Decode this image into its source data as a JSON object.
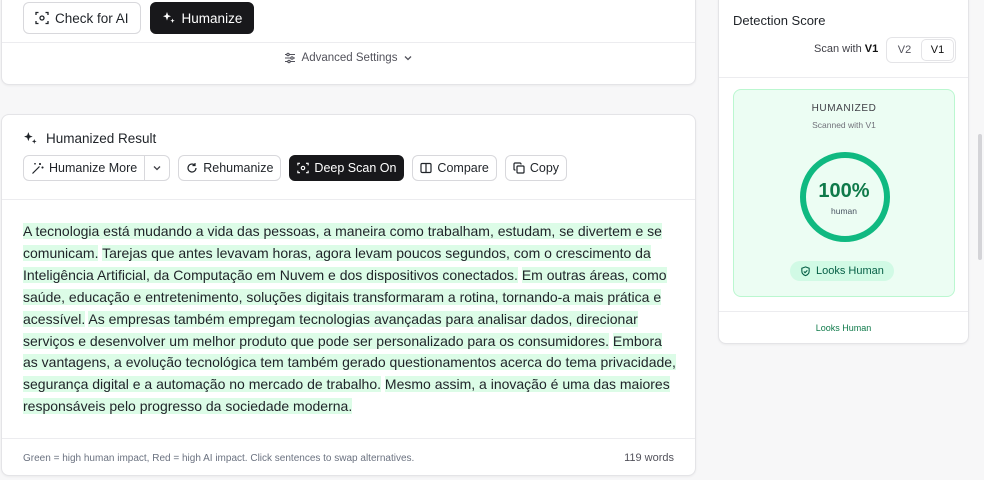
{
  "top": {
    "check_label": "Check for AI",
    "humanize_label": "Humanize",
    "advanced_settings": "Advanced Settings"
  },
  "result": {
    "title": "Humanized Result",
    "humanize_more": "Humanize More",
    "rehumanize": "Rehumanize",
    "deep_scan": "Deep Scan On",
    "compare": "Compare",
    "copy": "Copy",
    "sentences": [
      "A tecnologia está mudando a vida das pessoas, a maneira como trabalham, estudam, se divertem e se comunicam.",
      "Tarejas que antes levavam horas, agora levam poucos segundos, com o crescimento da Inteligência Artificial, da Computação em Nuvem e dos dispositivos conectados.",
      "Em outras áreas, como saúde, educação e entretenimento, soluções digitais transformaram a rotina, tornando-a mais prática e acessível.",
      "As empresas também empregam tecnologias avançadas para analisar dados, direcionar serviços e desenvolver um melhor produto que pode ser personalizado para os consumidores.",
      "Embora as vantagens, a evolução tecnológica tem também gerado questionamentos acerca do tema privacidade, segurança digital e a automação no mercado de trabalho.",
      "Mesmo assim, a inovação é uma das maiores responsáveis pelo progresso da sociedade moderna."
    ],
    "legend": "Green = high human impact, Red = high AI impact. Click sentences to swap alternatives.",
    "word_count": "119 words"
  },
  "detection": {
    "title": "Detection Score",
    "scan_with_prefix": "Scan with",
    "scan_with_version": "V1",
    "versions": [
      "V2",
      "V1"
    ],
    "status": "HUMANIZED",
    "scanned_with": "Scanned with V1",
    "percent": "100%",
    "percent_value": 100,
    "percent_sub": "human",
    "badge": "Looks Human",
    "footer": "Looks Human"
  },
  "colors": {
    "accent_green": "#0f7a4a",
    "highlight_green": "#dcfce7",
    "dark_button": "#18181b"
  },
  "icons": {
    "check": "scan-icon",
    "humanize": "sparkles-icon",
    "settings": "sliders-icon",
    "chevron": "chevron-down-icon",
    "rehumanize": "refresh-icon",
    "deep_scan": "scan-icon",
    "compare": "columns-icon",
    "copy": "copy-icon",
    "shield": "shield-check-icon"
  }
}
